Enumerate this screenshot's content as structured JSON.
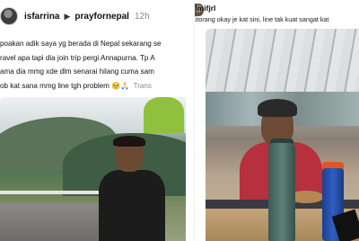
{
  "left_post": {
    "username": "isfarrina",
    "reply_to": "prayfornepal",
    "timestamp": "12h",
    "lines": [
      "poakan adik saya yg berada di Nepal sekarang se",
      "ravel apa tapi dia join trip pergi Annapurna. Tp A",
      "ama dia mmg xde dlm senarai hilang cuma sam",
      "ob kat sana mmg line tgh problem"
    ],
    "emoji": "🥺🙏🏻",
    "translate_label": "Trans"
  },
  "right_post": {
    "username": "zlmifjrl",
    "text": "Kitorang okay je kat sini, line tak kuat sangat kat"
  },
  "icons": {
    "reply_arrow": "right-triangle-icon"
  }
}
